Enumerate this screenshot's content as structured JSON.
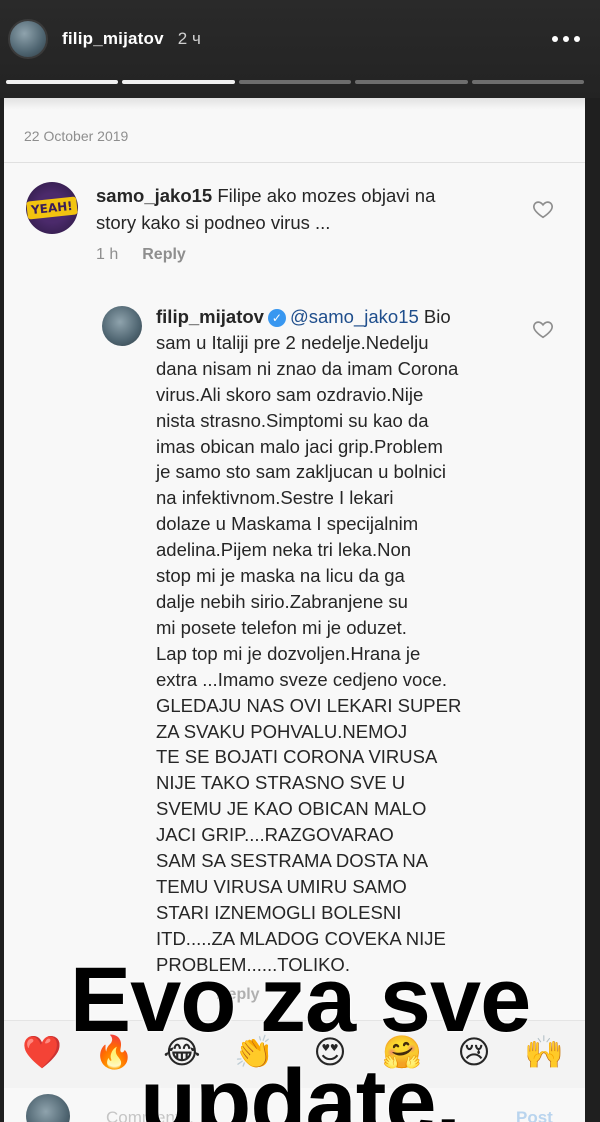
{
  "story": {
    "username": "filip_mijatov",
    "time": "2 ч",
    "progress": {
      "segments": 5,
      "viewed": 2
    }
  },
  "screenshot": {
    "date": "22 October 2019",
    "comment1": {
      "username": "samo_jako15",
      "text": "Filipe ako mozes objavi na story kako si podneo virus ...",
      "line1": "Filipe ako mozes objavi na",
      "line2": "story kako si podneo virus ...",
      "time": "1 h",
      "reply": "Reply",
      "avatar_text": "YEAH!"
    },
    "comment2": {
      "username": "filip_mijatov",
      "mention": "@samo_jako15",
      "first_line_end": "Bio",
      "lines": [
        "sam u Italiji pre 2 nedelje.Nedelju",
        "dana nisam ni znao da imam Corona",
        "virus.Ali skoro sam ozdravio.Nije",
        "nista strasno.Simptomi su kao da",
        "imas obican malo jaci grip.Problem",
        "je samo sto sam zakljucan u bolnici",
        "na infektivnom.Sestre I lekari",
        "dolaze u Maskama I specijalnim",
        "adelina.Pijem neka tri leka.Non",
        "stop mi je maska na licu da ga",
        "dalje nebih sirio.Zabranjene su",
        "mi posete telefon mi je oduzet.",
        "Lap top mi je dozvoljen.Hrana je",
        "extra ...Imamo sveze cedjeno voce.",
        "GLEDAJU NAS OVI LEKARI SUPER",
        "ZA SVAKU POHVALU.NEMOJ",
        "TE SE BOJATI CORONA VIRUSA",
        "NIJE TAKO STRASNO SVE U",
        "SVEMU JE KAO OBICAN MALO",
        "JACI GRIP....RAZGOVARAO",
        "SAM SA SESTRAMA DOSTA NA",
        "TEMU VIRUSA UMIRU SAMO",
        "STARI IZNEMOGLI BOLESNI",
        "ITD.....ZA MLADOG COVEKA NIJE",
        "PROBLEM......TOLIKO."
      ],
      "reply": "Reply"
    },
    "emojis": [
      "❤️",
      "🔥",
      "😂",
      "👏",
      "😍",
      "🤗",
      "😢",
      "🙌"
    ],
    "compose_placeholder": "Comment...",
    "post_label": "Post"
  },
  "overlay": {
    "line1": "Evo za sve",
    "line2": "update."
  },
  "colors": {
    "mention": "#1f4e8c",
    "verified": "#3897f0",
    "heart": "#e53935"
  }
}
